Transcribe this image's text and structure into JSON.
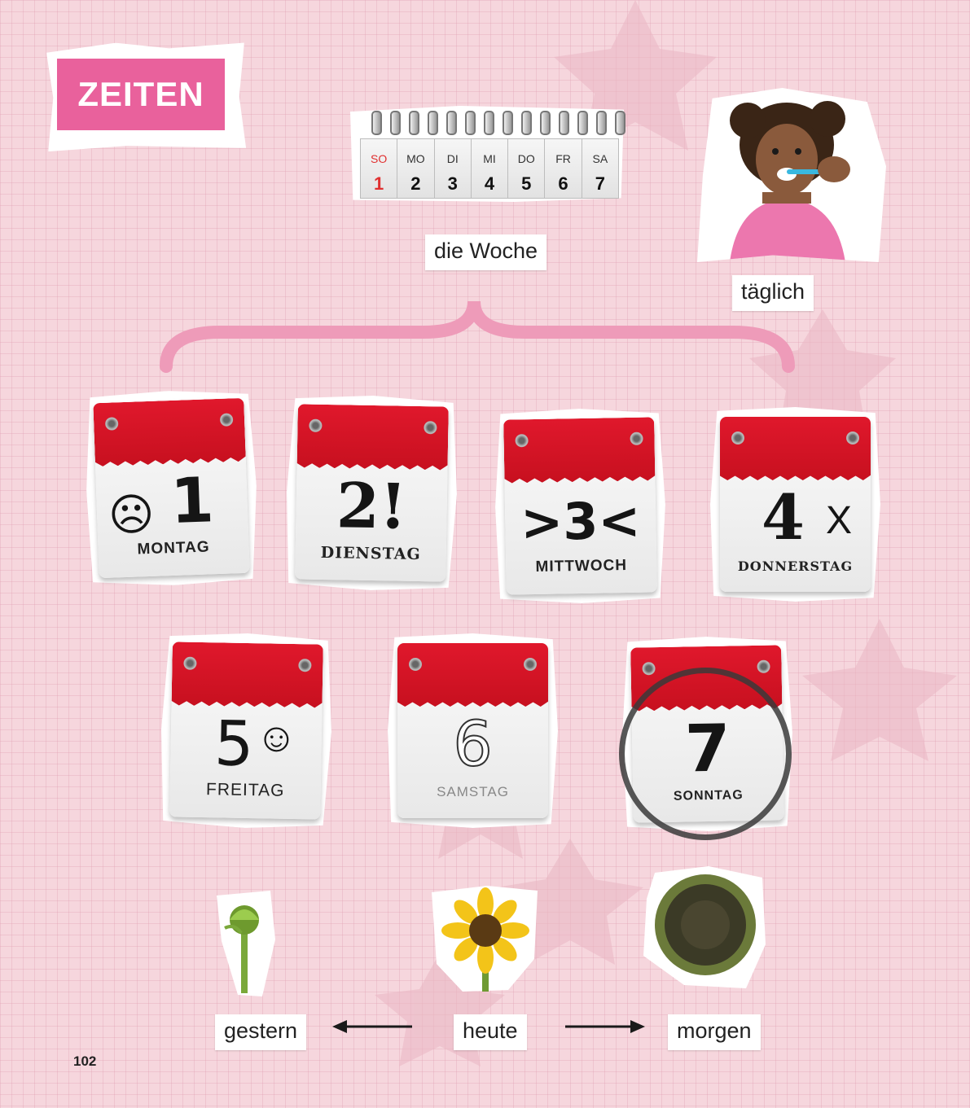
{
  "section_title": "ZEITEN",
  "week": {
    "days": [
      {
        "abbr": "SO",
        "num": "1"
      },
      {
        "abbr": "MO",
        "num": "2"
      },
      {
        "abbr": "DI",
        "num": "3"
      },
      {
        "abbr": "MI",
        "num": "4"
      },
      {
        "abbr": "DO",
        "num": "5"
      },
      {
        "abbr": "FR",
        "num": "6"
      },
      {
        "abbr": "SA",
        "num": "7"
      }
    ],
    "label": "die Woche"
  },
  "daily": {
    "label": "täglich"
  },
  "calendar_cards": [
    {
      "num": "1",
      "day": "MONTAG",
      "mark": "☹"
    },
    {
      "num": "2!",
      "day": "DIENSTAG",
      "mark": ""
    },
    {
      "num": ">3<",
      "day": "MITTWOCH",
      "mark": ""
    },
    {
      "num": "4",
      "day": "DONNERSTAG",
      "mark": "X"
    },
    {
      "num": "5",
      "day": "FREITAG",
      "mark": "☺"
    },
    {
      "num": "6",
      "day": "SAMSTAG",
      "mark": ""
    },
    {
      "num": "7",
      "day": "SONNTAG",
      "mark": ""
    }
  ],
  "timeline": {
    "yesterday": "gestern",
    "today": "heute",
    "tomorrow": "morgen"
  },
  "page_number": "102",
  "colors": {
    "accent": "#e9619c",
    "calendar_red": "#d6142a",
    "background": "#f6d6dd"
  }
}
